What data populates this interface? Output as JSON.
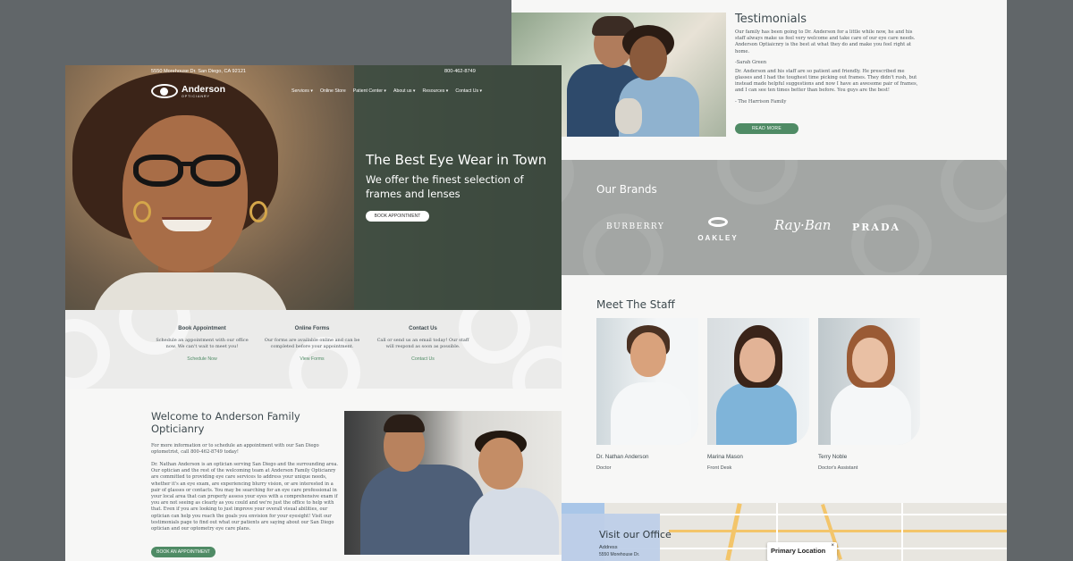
{
  "testimonials": {
    "title": "Testimonials",
    "quote1": "Our family has been going to Dr. Anderson for a little while now, he and his staff always make us feel very welcome and take care of our eye care needs. Anderson Optiaicnry is the best at what they do and make you feel right at home.",
    "author1": "-Sarah Green",
    "quote2": "Dr. Anderson and his staff are so patient and friendly. He prescribed me glasses and I had the toughest time picking out frames. They didn't rush, but instead made helpful suggestions and now I have an awesome pair of frames, and I can see ten times better than before. You guys are the best!",
    "author2": "- The Harrison Family",
    "read_more": "READ MORE"
  },
  "brands": {
    "title": "Our Brands",
    "items": [
      "BURBERRY",
      "OAKLEY",
      "Ray·Ban",
      "PRADA"
    ]
  },
  "staff": {
    "title": "Meet The Staff",
    "members": [
      {
        "name": "Dr. Nathan Anderson",
        "role": "Doctor"
      },
      {
        "name": "Marina Mason",
        "role": "Front Desk"
      },
      {
        "name": "Terry Noble",
        "role": "Doctor's Assistant"
      }
    ]
  },
  "visit": {
    "title": "Visit our Office",
    "address_label": "Address",
    "address": "5550 Morehouse Dr.",
    "map_popup": "Primary Location",
    "map_close": "×"
  },
  "header": {
    "address": "5550 Morehouse Dr. San Diego, CA 92121",
    "phone": "800-462-8749",
    "logo_name": "Anderson",
    "logo_sub": "OPTICIANRY",
    "nav": [
      "Services ▾",
      "Online Store",
      "Patient Center ▾",
      "About us ▾",
      "Resources ▾",
      "Contact Us ▾"
    ]
  },
  "hero": {
    "title": "The Best Eye Wear in Town",
    "subtitle": "We offer the finest selection of frames and lenses",
    "button": "BOOK APPOINTMENT"
  },
  "features": [
    {
      "title": "Book Appointment",
      "text": "Schedule an appointment with our office now. We can't wait to meet you!",
      "link": "Schedule Now"
    },
    {
      "title": "Online Forms",
      "text": "Our forms are available online and can be completed before your appointment.",
      "link": "View Forms"
    },
    {
      "title": "Contact Us",
      "text": "Call or send us an email today! Our staff will respond as soon as possible.",
      "link": "Contact Us"
    }
  ],
  "welcome": {
    "title": "Welcome to Anderson Family Opticianry",
    "p1": "For more information or to schedule an appointment with our San Diego optometrist, call 800-462-8749 today!",
    "p2": "Dr. Nathan Anderson is an optician serving San Diego and the surrounding area. Our optician and the rest of the welcoming team at Anderson Family Opticianry are committed to providing eye care services to address your unique needs, whether it's an eye exam, are experiencing blurry vision, or are interested in a pair of glasses or contacts. You may be searching for an eye care professional in your local area that can properly assess your eyes with a comprehensive exam if you are not seeing as clearly as you could and we're just the office to help with that. Even if you are looking to just improve your overall visual abilities, our optician can help you reach the goals you envision for your eyesight! Visit our testimonials page to find out what our patients are saying about our San Diego optician and our optometry eye care plans.",
    "button": "BOOK AN APPOINTMENT"
  }
}
